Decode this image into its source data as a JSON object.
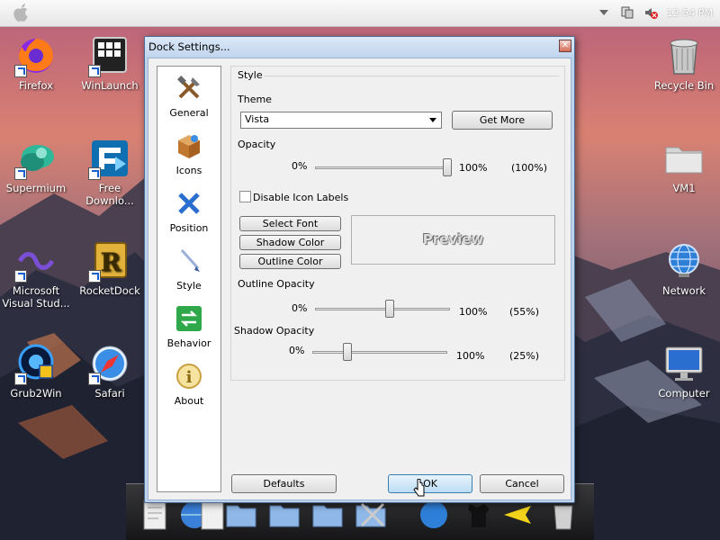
{
  "menubar": {
    "clock": "12:54 PM"
  },
  "desktop_icons": {
    "firefox": "Firefox",
    "winlaunch": "WinLaunch",
    "recycle_bin": "Recycle Bin",
    "supermium": "Supermium",
    "free_download": "Free\nDownlo...",
    "vm1": "VM1",
    "visual_studio": "Microsoft\nVisual Stud...",
    "rocketdock": "RocketDock",
    "network": "Network",
    "grub2win": "Grub2Win",
    "safari": "Safari",
    "computer": "Computer"
  },
  "dialog": {
    "title": "Dock Settings...",
    "close_label": "✕",
    "sidebar": [
      "General",
      "Icons",
      "Position",
      "Style",
      "Behavior",
      "About"
    ],
    "style_group": "Style",
    "theme_label": "Theme",
    "theme_value": "Vista",
    "get_more": "Get More",
    "opacity_label": "Opacity",
    "opacity_min": "0%",
    "opacity_max": "100%",
    "opacity_value": "(100%)",
    "opacity_fraction": 1.0,
    "disable_icon_labels": "Disable Icon Labels",
    "disable_icon_labels_checked": false,
    "select_font": "Select Font",
    "shadow_color": "Shadow Color",
    "outline_color": "Outline Color",
    "preview_text": "Preview",
    "outline_opacity_label": "Outline Opacity",
    "outline_min": "0%",
    "outline_max": "100%",
    "outline_value": "(55%)",
    "outline_fraction": 0.55,
    "shadow_opacity_label": "Shadow Opacity",
    "shadow_min": "0%",
    "shadow_max": "100%",
    "shadow_value": "(25%)",
    "shadow_fraction": 0.25,
    "defaults": "Defaults",
    "ok": "OK",
    "cancel": "Cancel"
  },
  "colors": {
    "accent": "#3c7fb1",
    "window_frame": "#bcd3ee"
  }
}
